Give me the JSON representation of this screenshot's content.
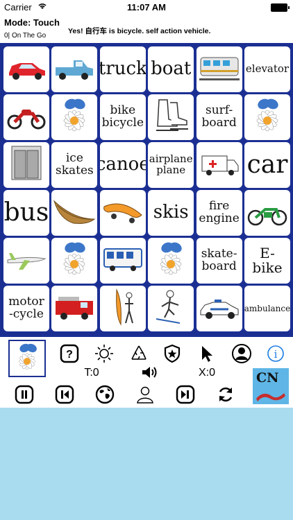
{
  "status": {
    "carrier": "Carrier",
    "time": "11:07 AM"
  },
  "header": {
    "mode": "Mode: Touch",
    "subtitle": "0| On The Go",
    "message": "Yes! 自行车 is bicycle. self action vehicle."
  },
  "board": {
    "cells": [
      {
        "label": "",
        "icon": "car-icon"
      },
      {
        "label": "",
        "icon": "pickup-truck-icon"
      },
      {
        "label": "truck",
        "icon": ""
      },
      {
        "label": "boat",
        "icon": ""
      },
      {
        "label": "",
        "icon": "train-icon"
      },
      {
        "label": "elevator",
        "icon": ""
      },
      {
        "label": "",
        "icon": "motorcycle-icon"
      },
      {
        "label": "",
        "icon": "daisy-butterfly-icon"
      },
      {
        "label": "bike bicycle",
        "icon": ""
      },
      {
        "label": "",
        "icon": "ice-skates-icon"
      },
      {
        "label": "surf-board",
        "icon": ""
      },
      {
        "label": "",
        "icon": "daisy-butterfly-icon"
      },
      {
        "label": "",
        "icon": "elevator-icon"
      },
      {
        "label": "ice skates",
        "icon": ""
      },
      {
        "label": "canoe",
        "icon": ""
      },
      {
        "label": "airplane plane",
        "icon": ""
      },
      {
        "label": "",
        "icon": "ambulance-icon"
      },
      {
        "label": "car",
        "icon": ""
      },
      {
        "label": "bus",
        "icon": ""
      },
      {
        "label": "",
        "icon": "canoe-icon"
      },
      {
        "label": "",
        "icon": "skateboard-icon"
      },
      {
        "label": "skis",
        "icon": ""
      },
      {
        "label": "fire engine",
        "icon": ""
      },
      {
        "label": "",
        "icon": "e-bike-icon"
      },
      {
        "label": "",
        "icon": "airplane-icon"
      },
      {
        "label": "",
        "icon": "daisy-butterfly-icon"
      },
      {
        "label": "",
        "icon": "bus-icon"
      },
      {
        "label": "",
        "icon": "daisy-butterfly-icon"
      },
      {
        "label": "skate-board",
        "icon": ""
      },
      {
        "label": "E-bike",
        "icon": ""
      },
      {
        "label": "motor -cycle",
        "icon": ""
      },
      {
        "label": "",
        "icon": "fire-engine-icon"
      },
      {
        "label": "",
        "icon": "surfboard-icon"
      },
      {
        "label": "",
        "icon": "skier-icon"
      },
      {
        "label": "",
        "icon": "police-car-icon"
      },
      {
        "label": "ambulance",
        "icon": ""
      }
    ]
  },
  "toolbar": {
    "t_counter": "T:0",
    "x_counter": "X:0",
    "logo_text": "CN",
    "icons_row1": [
      "help-icon",
      "brightness-icon",
      "recycle-icon",
      "shield-star-icon",
      "cursor-icon",
      "person-icon",
      "info-icon"
    ],
    "icons_row3": [
      "pause-icon",
      "previous-icon",
      "globe-icon",
      "user-outline-icon",
      "next-icon",
      "refresh-icon"
    ]
  }
}
